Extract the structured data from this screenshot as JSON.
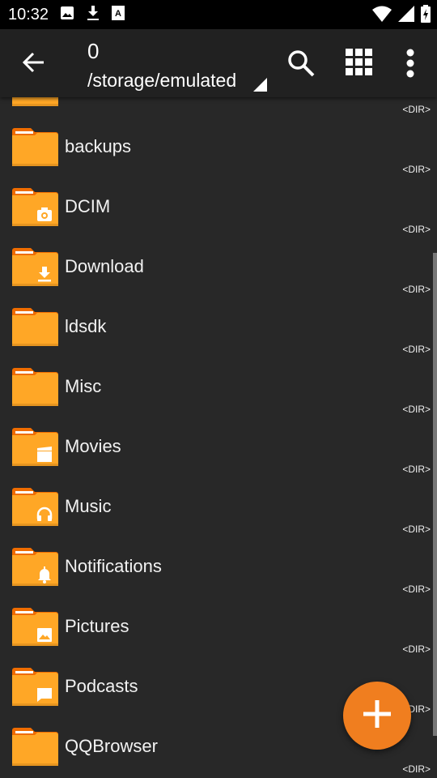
{
  "status_bar": {
    "time": "10:32",
    "icons": [
      "image-icon",
      "download-icon",
      "a-notification-icon",
      "wifi-icon",
      "signal-icon",
      "battery-charging-icon"
    ]
  },
  "app_bar": {
    "title": "0",
    "path": "/storage/emulated",
    "actions": [
      "back-icon",
      "search-icon",
      "grid-view-icon",
      "more-vert-icon"
    ]
  },
  "colors": {
    "folder": "#FFA726",
    "folder_tab": "#EF6C00",
    "fab": "#F07E1F",
    "background": "#282828",
    "app_bar": "#212121"
  },
  "files": [
    {
      "name": "",
      "badge": "",
      "type": "<DIR>"
    },
    {
      "name": "backups",
      "badge": "",
      "type": "<DIR>"
    },
    {
      "name": "DCIM",
      "badge": "camera",
      "type": "<DIR>"
    },
    {
      "name": "Download",
      "badge": "download",
      "type": "<DIR>"
    },
    {
      "name": "ldsdk",
      "badge": "",
      "type": "<DIR>"
    },
    {
      "name": "Misc",
      "badge": "",
      "type": "<DIR>"
    },
    {
      "name": "Movies",
      "badge": "movie",
      "type": "<DIR>"
    },
    {
      "name": "Music",
      "badge": "headphones",
      "type": "<DIR>"
    },
    {
      "name": "Notifications",
      "badge": "bell",
      "type": "<DIR>"
    },
    {
      "name": "Pictures",
      "badge": "image",
      "type": "<DIR>"
    },
    {
      "name": "Podcasts",
      "badge": "chat",
      "type": "<DIR>"
    },
    {
      "name": "QQBrowser",
      "badge": "",
      "type": "<DIR>"
    }
  ],
  "fab": {
    "icon": "add-icon"
  }
}
